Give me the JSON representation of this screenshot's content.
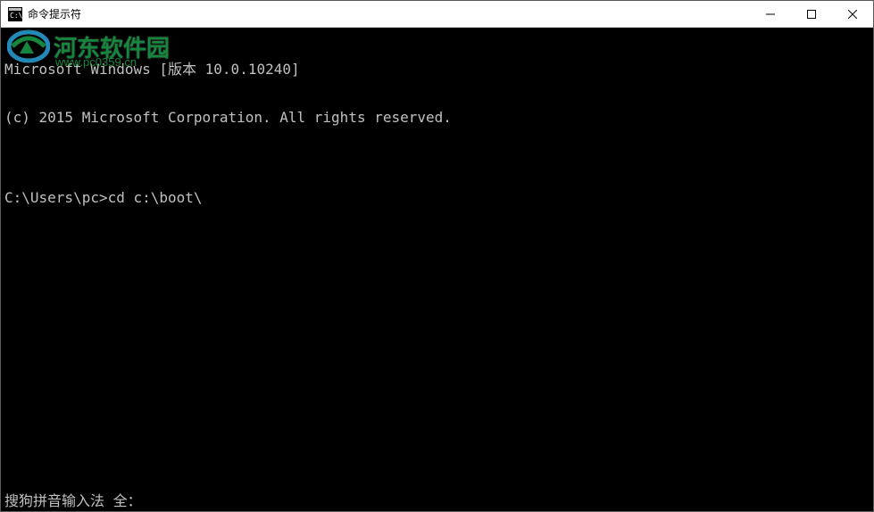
{
  "window": {
    "title": "命令提示符"
  },
  "terminal": {
    "line1": "Microsoft Windows [版本 10.0.10240]",
    "line2": "(c) 2015 Microsoft Corporation. All rights reserved.",
    "line3": "",
    "prompt": "C:\\Users\\pc>",
    "command": "cd c:\\boot\\",
    "ime_status": "搜狗拼音输入法 全："
  },
  "watermark": {
    "text": "河东软件园",
    "url": "www.pc0359.cn"
  }
}
